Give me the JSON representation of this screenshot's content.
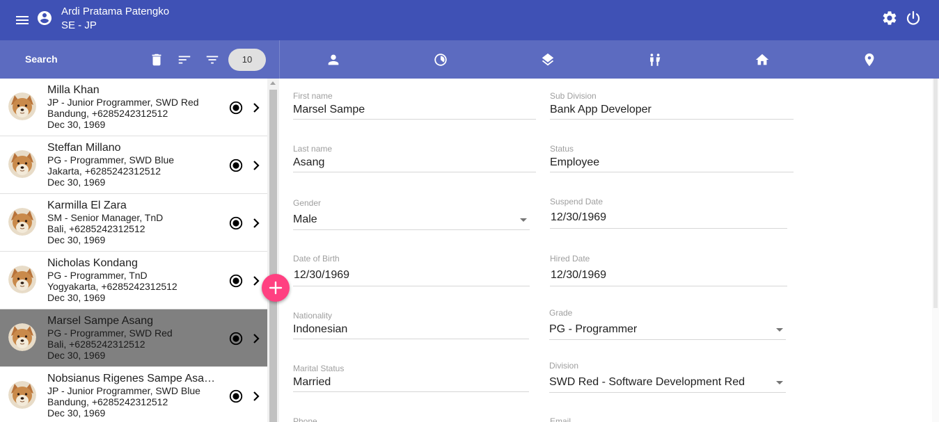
{
  "colors": {
    "primary": "#3f51b5",
    "primary_light": "#5c6bc0",
    "accent": "#ff4081",
    "selected_row": "#808080"
  },
  "header": {
    "menu_icon": "menu-icon",
    "account_icon": "account-circle-icon",
    "user_name": "Ardi Pratama Patengko",
    "user_role": "SE - JP",
    "settings_icon": "gear-icon",
    "power_icon": "power-icon"
  },
  "sidebar": {
    "search_label": "Search",
    "count": "10",
    "icons": [
      "delete-icon",
      "sort-icon",
      "filter-icon"
    ],
    "employees": [
      {
        "name": "Milla Khan",
        "position": "JP - Junior Programmer, SWD Red",
        "contact": "Bandung, +6285242312512",
        "date": "Dec 30, 1969",
        "selected": false
      },
      {
        "name": "Steffan Millano",
        "position": "PG - Programmer, SWD Blue",
        "contact": "Jakarta, +6285242312512",
        "date": "Dec 30, 1969",
        "selected": false
      },
      {
        "name": "Karmilla El Zara",
        "position": "SM - Senior Manager, TnD",
        "contact": "Bali, +6285242312512",
        "date": "Dec 30, 1969",
        "selected": false
      },
      {
        "name": "Nicholas Kondang",
        "position": "PG - Programmer, TnD",
        "contact": "Yogyakarta, +6285242312512",
        "date": "Dec 30, 1969",
        "selected": false
      },
      {
        "name": "Marsel Sampe Asang",
        "position": "PG - Programmer, SWD Red",
        "contact": "Bali, +6285242312512",
        "date": "Dec 30, 1969",
        "selected": true
      },
      {
        "name": "Nobsianus Rigenes Sampe Asa…",
        "position": "JP - Junior Programmer, SWD Blue",
        "contact": "Bandung, +6285242312512",
        "date": "Dec 30, 1969",
        "selected": false
      }
    ]
  },
  "fab": {
    "icon": "plus-icon"
  },
  "tabs": [
    {
      "icon": "person-icon"
    },
    {
      "icon": "timelapse-icon"
    },
    {
      "icon": "layers-icon"
    },
    {
      "icon": "family-icon"
    },
    {
      "icon": "home-icon"
    },
    {
      "icon": "location-pin-icon"
    }
  ],
  "form": {
    "first_name": {
      "label": "First name",
      "value": "Marsel Sampe"
    },
    "last_name": {
      "label": "Last name",
      "value": "Asang"
    },
    "gender": {
      "label": "Gender",
      "value": "Male"
    },
    "dob": {
      "label": "Date of Birth",
      "value": "12/30/1969"
    },
    "nationality": {
      "label": "Nationality",
      "value": "Indonesian"
    },
    "marital": {
      "label": "Marital Status",
      "value": "Married"
    },
    "phone": {
      "label": "Phone"
    },
    "sub_division": {
      "label": "Sub Division",
      "value": "Bank App Developer"
    },
    "status": {
      "label": "Status",
      "value": "Employee"
    },
    "suspend_date": {
      "label": "Suspend Date",
      "value": "12/30/1969"
    },
    "hired_date": {
      "label": "Hired Date",
      "value": "12/30/1969"
    },
    "grade": {
      "label": "Grade",
      "value": "PG - Programmer"
    },
    "division": {
      "label": "Division",
      "value": "SWD Red - Software Development Red"
    },
    "email": {
      "label": "Email"
    }
  }
}
